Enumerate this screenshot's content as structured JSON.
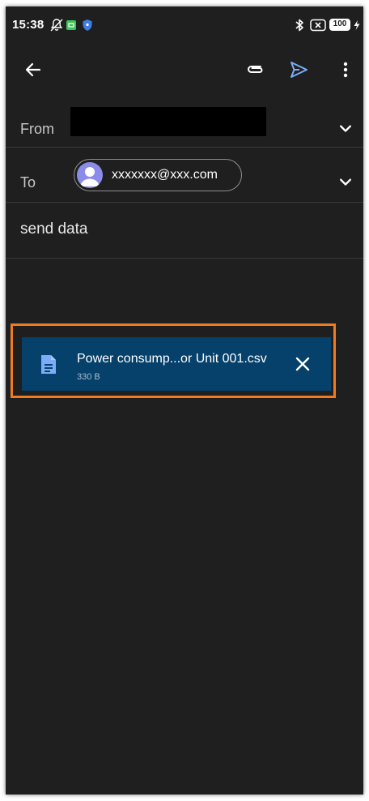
{
  "status_bar": {
    "time": "15:38",
    "battery": "100",
    "icons": [
      "notifications-off-icon",
      "app-badge-icon",
      "shield-icon",
      "bluetooth-icon",
      "sim-off-icon",
      "battery-icon",
      "charging-icon"
    ]
  },
  "toolbar": {
    "back_icon": "arrow-left-icon",
    "attach_icon": "paperclip-icon",
    "send_icon": "send-icon",
    "more_icon": "more-vert-icon"
  },
  "compose": {
    "from_label": "From",
    "to_label": "To",
    "recipient": "xxxxxxx@xxx.com",
    "subject": "send data"
  },
  "attachment": {
    "name": "Power consump...or Unit 001.csv",
    "size": "330 B"
  },
  "colors": {
    "background": "#1f1f1f",
    "attachment_bg": "#06416b",
    "accent": "#7cacf8",
    "highlight": "#f07c22",
    "avatar": "#8b8ce9"
  }
}
